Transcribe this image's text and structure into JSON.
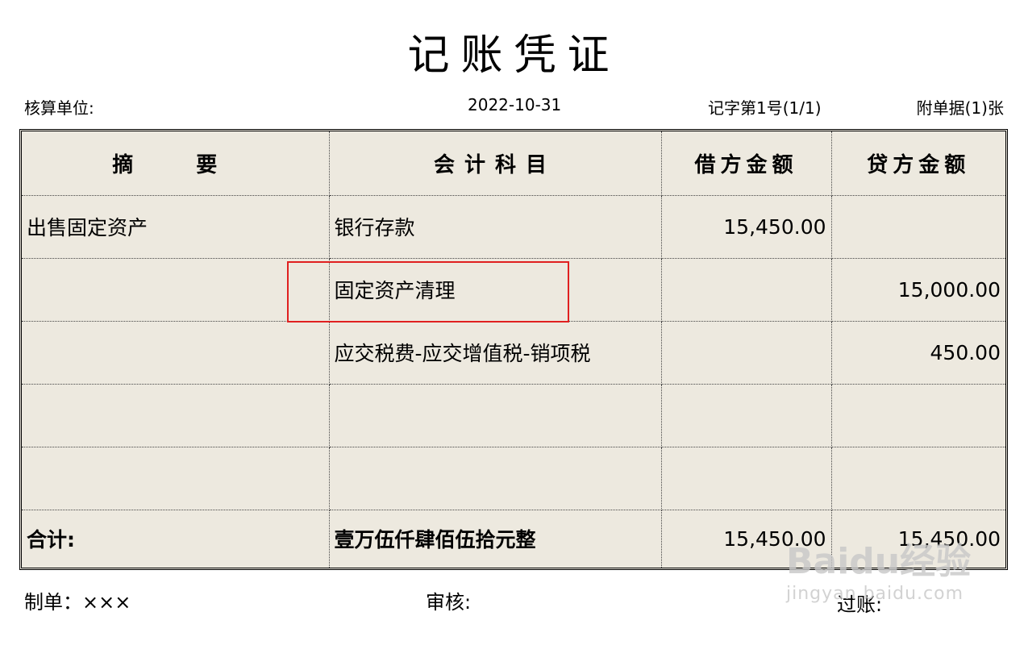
{
  "title": "记账凭证",
  "header": {
    "unit_label": "核算单位:",
    "date": "2022-10-31",
    "voucher_no": "记字第1号(1/1)",
    "attachments": "附单据(1)张"
  },
  "table": {
    "columns": [
      "摘　要",
      "会计科目",
      "借方金额",
      "贷方金额"
    ],
    "rows": [
      {
        "summary": "出售固定资产",
        "account": "银行存款",
        "debit": "15,450.00",
        "credit": ""
      },
      {
        "summary": "",
        "account": "固定资产清理",
        "debit": "",
        "credit": "15,000.00"
      },
      {
        "summary": "",
        "account": "应交税费-应交增值税-销项税",
        "debit": "",
        "credit": "450.00"
      },
      {
        "summary": "",
        "account": "",
        "debit": "",
        "credit": ""
      },
      {
        "summary": "",
        "account": "",
        "debit": "",
        "credit": ""
      }
    ],
    "total": {
      "label": "合计:",
      "amount_in_words": "壹万伍仟肆佰伍拾元整",
      "debit": "15,450.00",
      "credit": "15,450.00"
    }
  },
  "footer": {
    "maker": "制单：×××",
    "reviewer": "审核:",
    "poster": "过账:"
  },
  "watermark": {
    "logo": "Baidu经验",
    "url": "jingyan.baidu.com"
  },
  "colors": {
    "table_bg": "#ede9df",
    "highlight": "#e02020"
  }
}
